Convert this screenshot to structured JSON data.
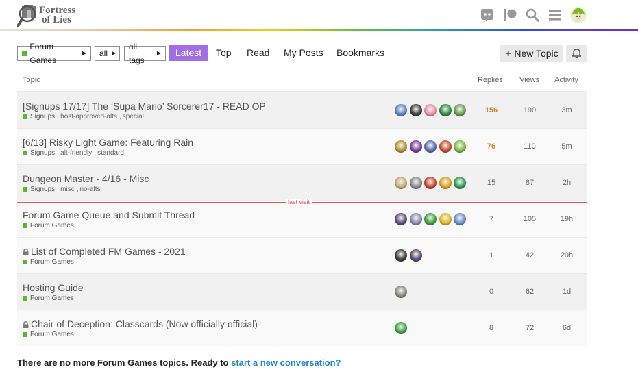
{
  "header": {
    "logo_line1": "Fortress",
    "logo_line2": "of Lies",
    "icons": [
      "discord-icon",
      "patreon-icon",
      "search-icon",
      "hamburger-menu-icon",
      "user-avatar"
    ]
  },
  "nav": {
    "category_dropdown": "Forum Games",
    "subcategory_dropdown": "all",
    "tags_dropdown": "all tags",
    "tabs": [
      "Latest",
      "Top",
      "Read",
      "My Posts",
      "Bookmarks"
    ],
    "active_tab": "Latest",
    "new_topic_label": "New Topic"
  },
  "table": {
    "headers": {
      "topic": "Topic",
      "replies": "Replies",
      "views": "Views",
      "activity": "Activity"
    },
    "last_visit_label": "last visit",
    "rows": [
      {
        "title": "[Signups 17/17] The ‘Supa Mario’ Sorcerer17 - READ OP",
        "category": "Signups",
        "tags": [
          "host-approved-alts",
          "special"
        ],
        "locked": false,
        "replies": "156",
        "views": "190",
        "activity": "3m",
        "hot": true,
        "avatars": [
          "#5a7fc8",
          "#3a3a3a",
          "#e890a0",
          "#2a8a3a",
          "#6a9a4a"
        ]
      },
      {
        "title": "[6/13] Risky Light Game: Featuring Rain",
        "category": "Signups",
        "tags": [
          "alt-friendly",
          "standard"
        ],
        "locked": false,
        "replies": "76",
        "views": "110",
        "activity": "5m",
        "hot": true,
        "avatars": [
          "#b89030",
          "#7a3a9a",
          "#5a6aa8",
          "#c84a2a",
          "#7ab840"
        ]
      },
      {
        "title": "Dungeon Master - 4/16 - Misc",
        "category": "Signups",
        "tags": [
          "misc",
          "no-alts"
        ],
        "locked": false,
        "replies": "15",
        "views": "87",
        "activity": "2h",
        "hot": false,
        "avatars": [
          "#c8a870",
          "#8a8a8a",
          "#c8402a",
          "#e0a020",
          "#2a9a4a"
        ]
      },
      {
        "title": "Forum Game Queue and Submit Thread",
        "category": "Forum Games",
        "tags": [],
        "locked": false,
        "replies": "7",
        "views": "105",
        "activity": "19h",
        "hot": false,
        "avatars": [
          "#5a4a7a",
          "#8a8aa8",
          "#3aa040",
          "#e0b820",
          "#6a8ac8"
        ]
      },
      {
        "title": "List of Completed FM Games - 2021",
        "category": "Forum Games",
        "tags": [],
        "locked": true,
        "replies": "1",
        "views": "42",
        "activity": "20h",
        "hot": false,
        "avatars": [
          "#3a3a3a",
          "#5a4a6a"
        ]
      },
      {
        "title": "Hosting Guide",
        "category": "Forum Games",
        "tags": [],
        "locked": false,
        "replies": "0",
        "views": "62",
        "activity": "1d",
        "hot": false,
        "avatars": [
          "#8a8a80"
        ]
      },
      {
        "title": "Chair of Deception: Classcards (Now officially official)",
        "category": "Forum Games",
        "tags": [],
        "locked": true,
        "replies": "8",
        "views": "72",
        "activity": "6d",
        "hot": false,
        "avatars": [
          "#3aa040"
        ]
      }
    ]
  },
  "footer": {
    "text": "There are no more Forum Games topics. Ready to ",
    "link": "start a new conversation?"
  },
  "colors": {
    "accent": "#a26ee3",
    "category_green": "#5cb82a",
    "hot": "#c8843a",
    "link": "#1e87c5",
    "last_visit": "#e45555"
  }
}
